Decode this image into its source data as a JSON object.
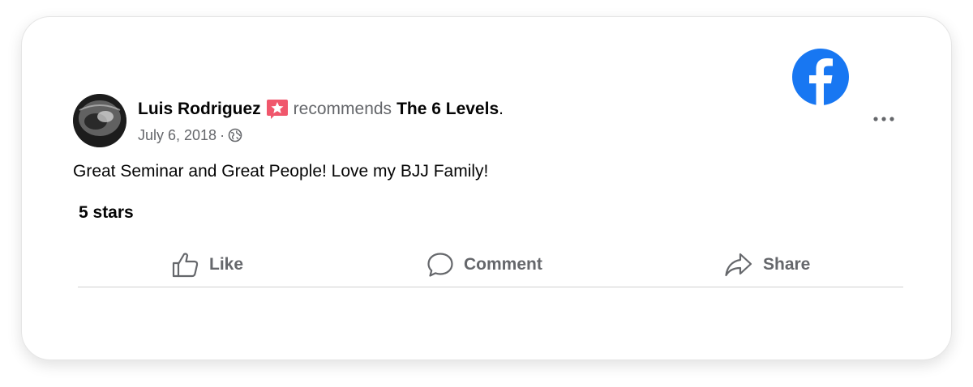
{
  "post": {
    "author": "Luis Rodriguez",
    "recommends_text": "recommends",
    "page_name": "The 6 Levels",
    "period": ".",
    "date": "July 6, 2018",
    "separator": "·",
    "audience_icon": "globe-icon",
    "review_text": "Great Seminar and Great People! Love my BJJ Family!",
    "rating_label": "5 stars"
  },
  "actions": {
    "like_label": "Like",
    "comment_label": "Comment",
    "share_label": "Share"
  },
  "icons": {
    "brand": "facebook-logo-icon",
    "more": "more-options-icon",
    "recommend": "recommend-badge-icon"
  },
  "colors": {
    "facebook_blue": "#1877f2",
    "recommend_red": "#f0576c",
    "secondary_text": "#65676b",
    "primary_text": "#050505"
  }
}
